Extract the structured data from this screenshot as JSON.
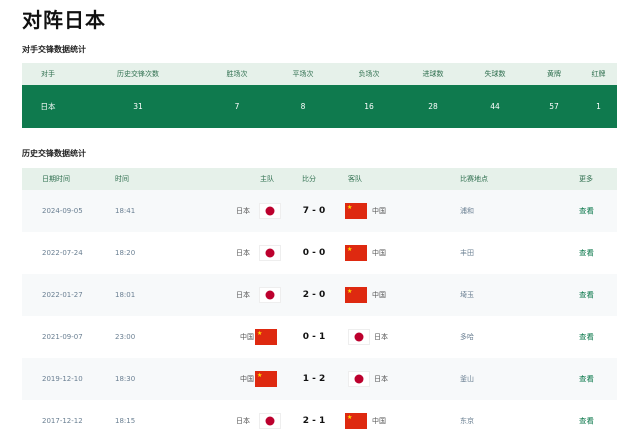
{
  "page_title": "对阵日本",
  "summary": {
    "title": "对手交锋数据统计",
    "headers": [
      "对手",
      "历史交锋次数",
      "胜场次",
      "平场次",
      "负场次",
      "进球数",
      "失球数",
      "黄牌",
      "红牌"
    ],
    "row": [
      "日本",
      "31",
      "7",
      "8",
      "16",
      "28",
      "44",
      "57",
      "1"
    ]
  },
  "history": {
    "title": "历史交锋数据统计",
    "headers": {
      "date": "日期时间",
      "time": "时间",
      "home": "主队",
      "score": "比分",
      "away": "客队",
      "venue": "比赛地点",
      "more": "更多"
    },
    "rows": [
      {
        "date": "2024-09-05",
        "time": "18:41",
        "home": "日本",
        "home_flag": "japan-flag-icon",
        "score": "7 - 0",
        "away": "中国",
        "away_flag": "china-flag-icon",
        "venue": "浦和",
        "more": "查看"
      },
      {
        "date": "2022-07-24",
        "time": "18:20",
        "home": "日本",
        "home_flag": "japan-flag-icon",
        "score": "0 - 0",
        "away": "中国",
        "away_flag": "china-flag-icon",
        "venue": "丰田",
        "more": "查看"
      },
      {
        "date": "2022-01-27",
        "time": "18:01",
        "home": "日本",
        "home_flag": "japan-flag-icon",
        "score": "2 - 0",
        "away": "中国",
        "away_flag": "china-flag-icon",
        "venue": "埼玉",
        "more": "查看"
      },
      {
        "date": "2021-09-07",
        "time": "23:00",
        "home": "中国",
        "home_flag": "china-flag-icon",
        "score": "0 - 1",
        "away": "日本",
        "away_flag": "japan-flag-icon",
        "venue": "多哈",
        "more": "查看"
      },
      {
        "date": "2019-12-10",
        "time": "18:30",
        "home": "中国",
        "home_flag": "china-flag-icon",
        "score": "1 - 2",
        "away": "日本",
        "away_flag": "japan-flag-icon",
        "venue": "釜山",
        "more": "查看"
      },
      {
        "date": "2017-12-12",
        "time": "18:15",
        "home": "日本",
        "home_flag": "japan-flag-icon",
        "score": "2 - 1",
        "away": "中国",
        "away_flag": "china-flag-icon",
        "venue": "东京",
        "more": "查看"
      }
    ]
  },
  "colors": {
    "accent": "#0f7a4e",
    "header_bg": "#e6f1ea",
    "japan_red": "#bc002d",
    "china_red": "#de2910",
    "china_star": "#ffde00"
  }
}
